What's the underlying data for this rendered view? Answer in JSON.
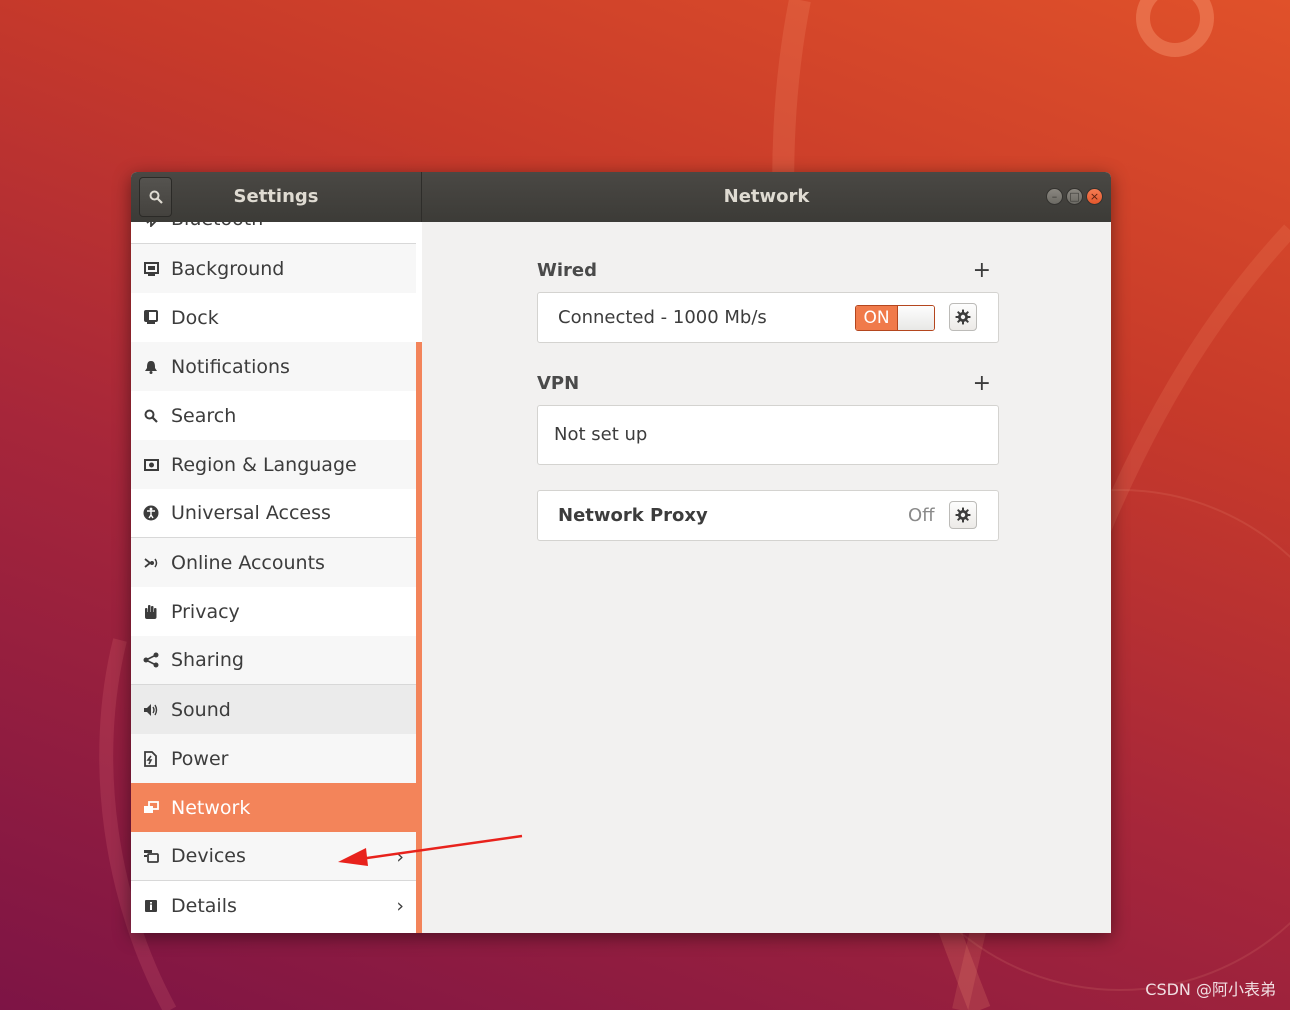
{
  "window": {
    "sidebar_title": "Settings",
    "panel_title": "Network",
    "wm_buttons": {
      "minimize": "–",
      "maximize": "□",
      "close": "×"
    }
  },
  "sidebar": {
    "items": [
      {
        "label": "Bluetooth",
        "icon": "bluetooth-icon"
      },
      {
        "label": "Background",
        "icon": "background-icon"
      },
      {
        "label": "Dock",
        "icon": "dock-icon"
      },
      {
        "label": "Notifications",
        "icon": "bell-icon"
      },
      {
        "label": "Search",
        "icon": "search-icon"
      },
      {
        "label": "Region & Language",
        "icon": "region-icon"
      },
      {
        "label": "Universal Access",
        "icon": "accessibility-icon"
      },
      {
        "label": "Online Accounts",
        "icon": "online-accounts-icon"
      },
      {
        "label": "Privacy",
        "icon": "hand-icon"
      },
      {
        "label": "Sharing",
        "icon": "share-icon"
      },
      {
        "label": "Sound",
        "icon": "speaker-icon"
      },
      {
        "label": "Power",
        "icon": "power-icon"
      },
      {
        "label": "Network",
        "icon": "network-icon"
      },
      {
        "label": "Devices",
        "icon": "devices-icon",
        "chevron": "›"
      },
      {
        "label": "Details",
        "icon": "info-icon",
        "chevron": "›"
      }
    ],
    "selected": "Network"
  },
  "network": {
    "wired": {
      "heading": "Wired",
      "add": "+",
      "status": "Connected - 1000 Mb/s",
      "toggle_label": "ON"
    },
    "vpn": {
      "heading": "VPN",
      "add": "+",
      "status": "Not set up"
    },
    "proxy": {
      "label": "Network Proxy",
      "state": "Off"
    }
  },
  "watermark": "CSDN @阿小表弟",
  "colors": {
    "accent": "#f3845a",
    "titlebar": "#3c3b37",
    "close_button": "#e4572c"
  }
}
